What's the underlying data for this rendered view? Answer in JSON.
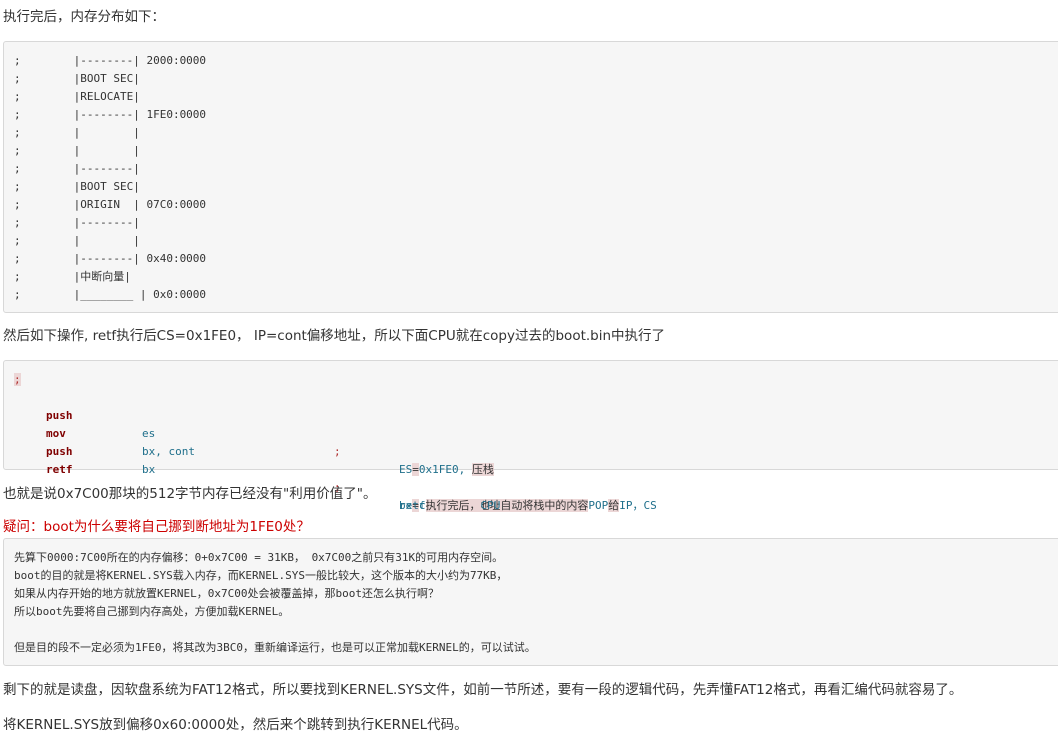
{
  "paragraphs": {
    "p1": "执行完后，内存分布如下：",
    "p2": "然后如下操作, retf执行后CS=0x1FE0， IP=cont偏移地址，所以下面CPU就在copy过去的boot.bin中执行了",
    "p3": "也就是说0x7C00那块的512字节内存已经没有\"利用价值了\"。",
    "p4": "疑问：boot为什么要将自己挪到断地址为1FE0处？",
    "p5": "剩下的就是读盘，因软盘系统为FAT12格式，所以要找到KERNEL.SYS文件，如前一节所述，要有一段的逻辑代码，先弄懂FAT12格式，再看汇编代码就容易了。",
    "p6": "将KERNEL.SYS放到偏移0x60:0000处，然后来个跳转到执行KERNEL代码。"
  },
  "memory_map": [
    ";        |--------| 2000:0000",
    ";        |BOOT SEC|",
    ";        |RELOCATE|",
    ";        |--------| 1FE0:0000",
    ";        |        |",
    ";        |        |",
    ";        |--------|",
    ";        |BOOT SEC|",
    ";        |ORIGIN  | 07C0:0000",
    ";        |--------|",
    ";        |        |",
    ";        |--------| 0x40:0000",
    ";        |中断向量|",
    ";        |________ | 0x0:0000"
  ],
  "asm": {
    "lead": ";",
    "lines": [
      {
        "op": "push",
        "arg": "es",
        "semi": ";",
        "c1": "ES",
        "c2": "=",
        "c3": "0x1FE0,",
        "c4": "压栈"
      },
      {
        "op": "mov",
        "arg": "bx, cont",
        "semi": "",
        "c1": "",
        "c2": "",
        "c3": "",
        "c4": ""
      },
      {
        "op": "push",
        "arg": "bx",
        "semi": ";",
        "c1": "bx",
        "c2": "=",
        "c3": "cont",
        "c4": "的偏移地址， 压栈"
      },
      {
        "op": "retf",
        "arg": "",
        "semi": ";",
        "c1": "retf",
        "c2": "执行完后，",
        "c3": "CPU",
        "c4": "自动将栈中的内容",
        "c5": "POP",
        "c6": "给",
        "c7": "IP，CS"
      }
    ]
  },
  "answer": [
    "先算下0000:7C00所在的内存偏移：0+0x7C00 = 31KB， 0x7C00之前只有31K的可用内存空间。",
    "boot的目的就是将KERNEL.SYS载入内存，而KERNEL.SYS一般比较大，这个版本的大小约为77KB，",
    "如果从内存开始的地方就放置KERNEL，0x7C00处会被覆盖掉，那boot还怎么执行啊？",
    "所以boot先要将自己挪到内存高处，方便加载KERNEL。",
    "",
    "但是目的段不一定必须为1FE0，将其改为3BC0，重新编译运行，也是可以正常加载KERNEL的，可以试试。"
  ]
}
